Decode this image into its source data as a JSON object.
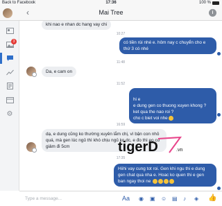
{
  "status": {
    "back": "Back to Facebook",
    "time": "17:36",
    "battery": "100 %"
  },
  "header": {
    "title": "Mai Tree"
  },
  "sidebar": {
    "badge": "3"
  },
  "messages": [
    {
      "dir": "in",
      "text": "khi nao e nhan dc hang vay chi"
    },
    {
      "time": "10:27"
    },
    {
      "dir": "out",
      "text": "có tiền rùi nhé e. hôm nay c chuyển cho e thứ 3 có nhé"
    },
    {
      "time": "11:48"
    },
    {
      "dir": "in",
      "text": "Da, e cam on"
    },
    {
      "time": "11:52"
    },
    {
      "dir": "out",
      "text": "hi e\ne dung gen co thuong xuyen khong ? ket qua the nao roi ?\ncho c biet voi nhe"
    },
    {
      "time": "16:59"
    },
    {
      "dir": "in",
      "text": "dạ, e dung cũng ko thường xuyên lắm chị, vì bận con nhỏ quá, mà gen lúc ngủ thì khó chịu ngủ ko dc, e đo thì eo có giảm đi 5cm"
    },
    {
      "time": "17:35"
    },
    {
      "dir": "out",
      "text": "Hiihi vay cung tot roi. Gen khi ngu thi e dung gen chat qua nha e. Hoac ko quen thi e gen ban ngay thoi ne"
    }
  ],
  "watermark": {
    "brand": "tigerD",
    "suffix": ".vn"
  },
  "composer": {
    "placeholder": "Type a message...",
    "aa": "Aa"
  },
  "colors": {
    "accent": "#2e5ca9",
    "bubble_in": "#eceef1",
    "watermark_pink": "#e8458b"
  }
}
